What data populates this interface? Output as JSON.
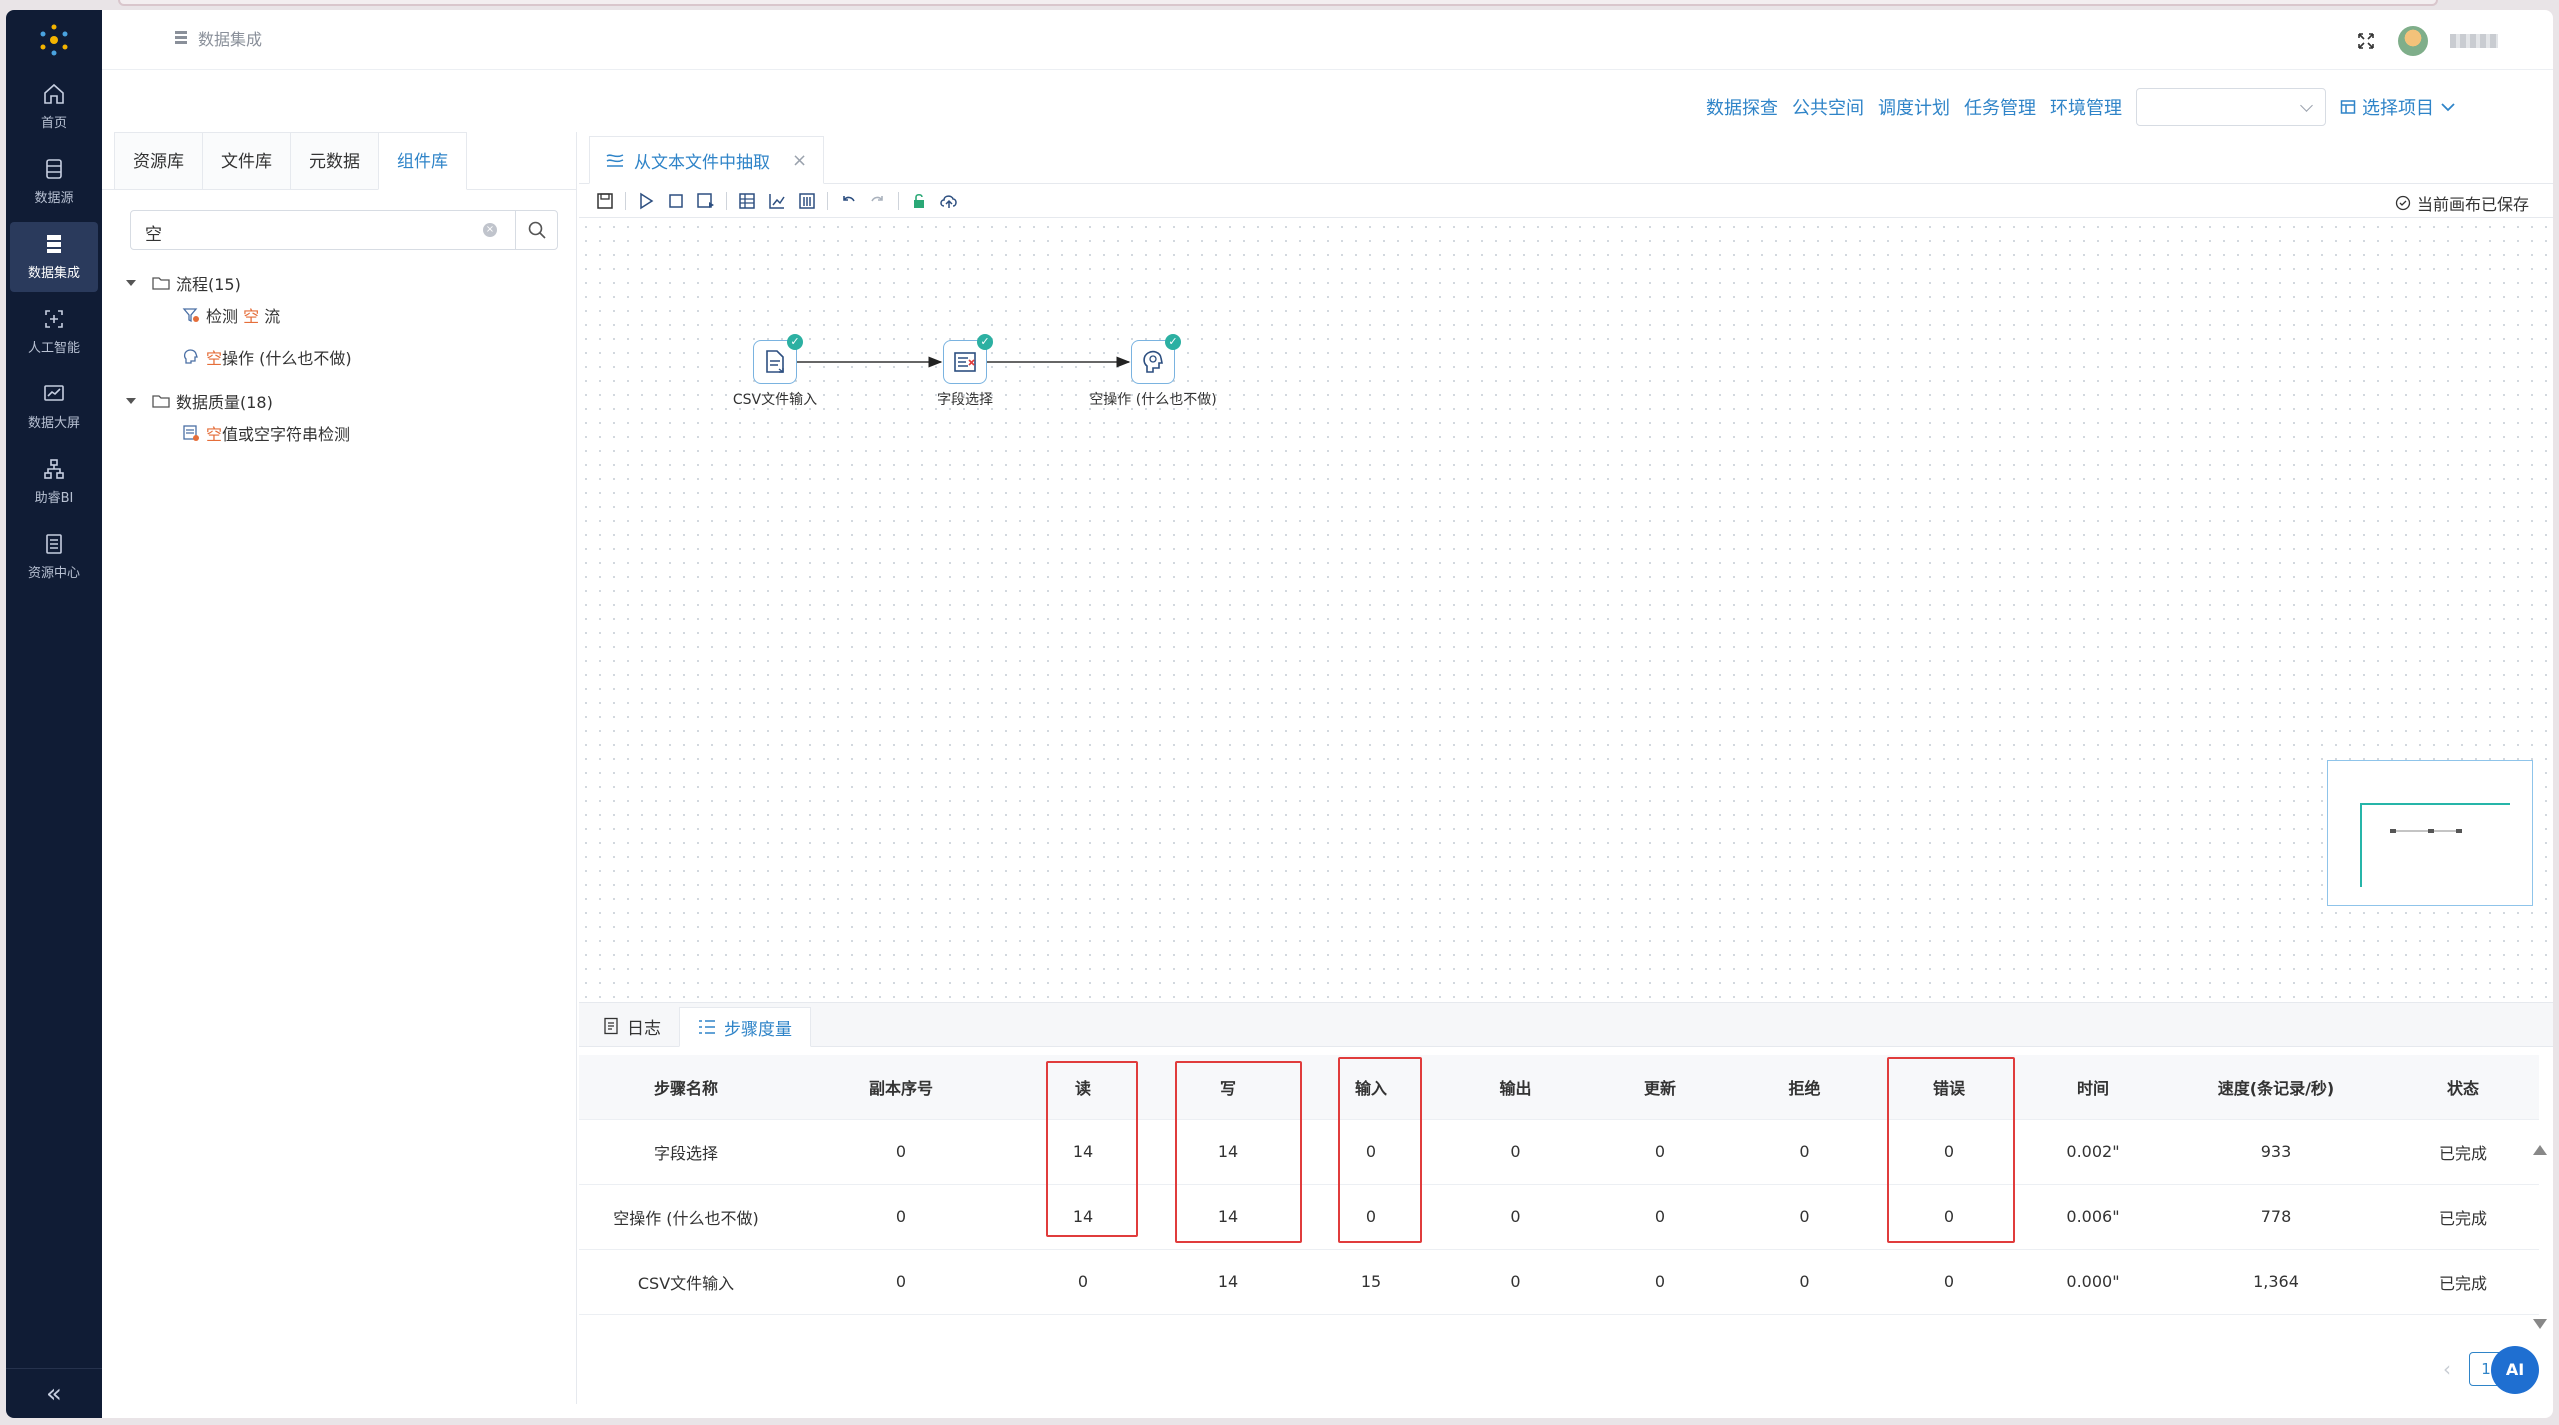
{
  "sidebar": {
    "items": [
      {
        "label": "首页",
        "icon": "home-icon"
      },
      {
        "label": "数据源",
        "icon": "database-icon"
      },
      {
        "label": "数据集成",
        "icon": "integration-icon"
      },
      {
        "label": "人工智能",
        "icon": "ai-icon"
      },
      {
        "label": "数据大屏",
        "icon": "dashboard-icon"
      },
      {
        "label": "助睿BI",
        "icon": "bi-icon"
      },
      {
        "label": "资源中心",
        "icon": "resource-icon"
      }
    ],
    "active_index": 2,
    "collapse_label": "«"
  },
  "header": {
    "breadcrumb": "数据集成"
  },
  "topmenu": {
    "items": [
      "数据探查",
      "公共空间",
      "调度计划",
      "任务管理",
      "环境管理"
    ],
    "project_select_value": "",
    "choose_project": "选择项目"
  },
  "leftpanel": {
    "tabs": [
      "资源库",
      "文件库",
      "元数据",
      "组件库"
    ],
    "active_tab": 3,
    "search": {
      "value": "空"
    },
    "tree": [
      {
        "type": "folder",
        "label": "流程(15)"
      },
      {
        "type": "leaf",
        "pre": "检测",
        "hl": "空",
        "post": "流"
      },
      {
        "type": "leaf",
        "pre": "",
        "hl": "空",
        "post": "操作 (什么也不做)"
      },
      {
        "type": "folder",
        "label": "数据质量(18)"
      },
      {
        "type": "leaf",
        "pre": "",
        "hl": "空",
        "post": "值或空字符串检测"
      }
    ]
  },
  "editor": {
    "tab_title": "从文本文件中抽取",
    "saved_status": "当前画布已保存",
    "nodes": [
      {
        "label": "CSV文件输入",
        "icon": "file-input-icon"
      },
      {
        "label": "字段选择",
        "icon": "field-select-icon"
      },
      {
        "label": "空操作 (什么也不做)",
        "icon": "dummy-icon"
      }
    ]
  },
  "bottom": {
    "tabs": [
      "日志",
      "步骤度量"
    ],
    "active_tab": 1,
    "columns": [
      "步骤名称",
      "副本序号",
      "读",
      "写",
      "输入",
      "输出",
      "更新",
      "拒绝",
      "错误",
      "时间",
      "速度(条记录/秒)",
      "状态"
    ],
    "rows": [
      [
        "字段选择",
        "0",
        "14",
        "14",
        "0",
        "0",
        "0",
        "0",
        "0",
        "0.002\"",
        "933",
        "已完成"
      ],
      [
        "空操作 (什么也不做)",
        "0",
        "14",
        "14",
        "0",
        "0",
        "0",
        "0",
        "0",
        "0.006\"",
        "778",
        "已完成"
      ],
      [
        "CSV文件输入",
        "0",
        "0",
        "14",
        "15",
        "0",
        "0",
        "0",
        "0",
        "0.000\"",
        "1,364",
        "已完成"
      ]
    ],
    "page": "1",
    "ai_label": "AI"
  },
  "colors": {
    "accent": "#2f84c8",
    "sidebar_bg": "#101c35",
    "highlight": "#e56e3a",
    "annotation_red": "#e03c3c",
    "success": "#2cb0a2"
  }
}
